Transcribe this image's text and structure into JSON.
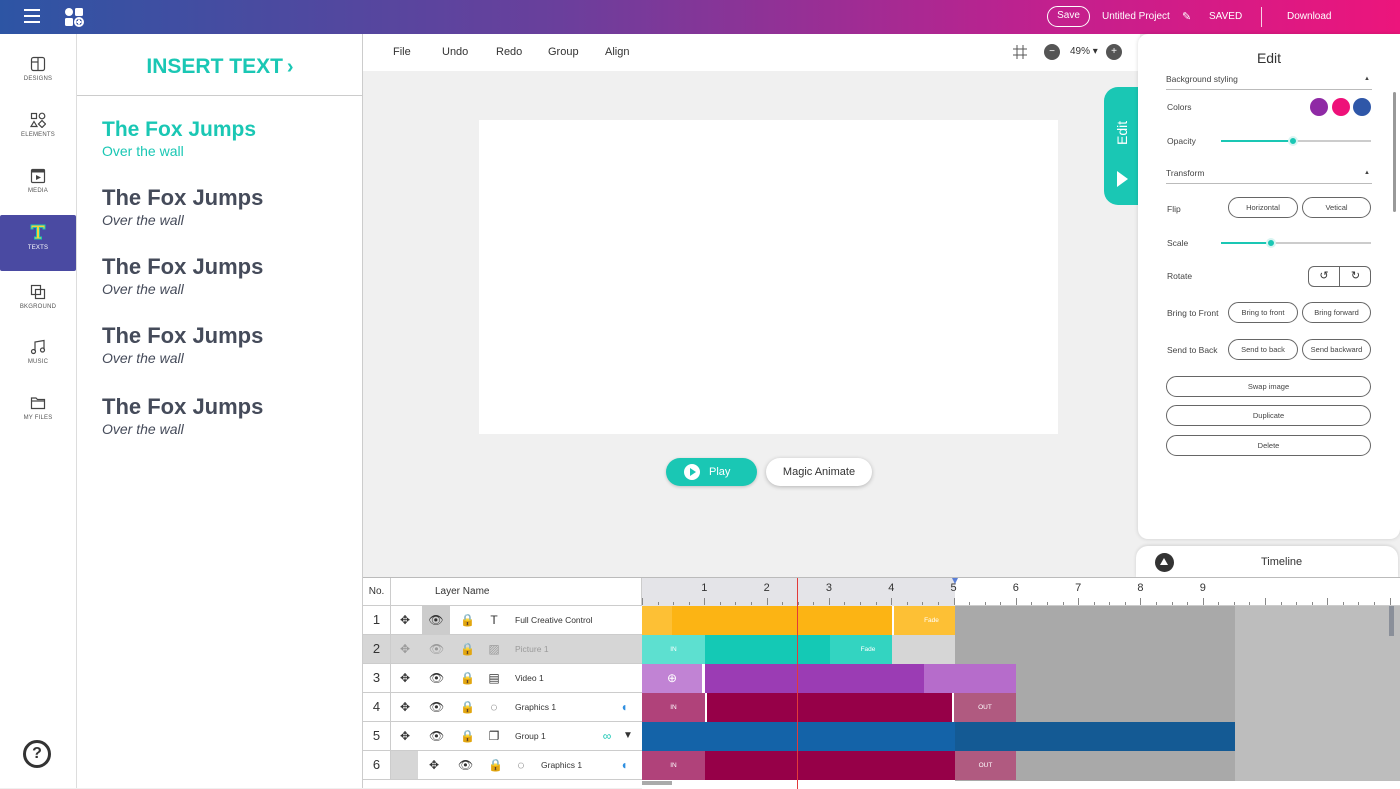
{
  "topbar": {
    "save_label": "Save",
    "project_name": "Untitled Project",
    "saved_status": "SAVED",
    "download_label": "Download"
  },
  "sidebar": {
    "items": [
      {
        "label": "DESIGNS",
        "icon": "designs-icon"
      },
      {
        "label": "ELEMENTS",
        "icon": "elements-icon"
      },
      {
        "label": "MEDIA",
        "icon": "media-icon"
      },
      {
        "label": "TEXTS",
        "icon": "texts-icon"
      },
      {
        "label": "BKGROUND",
        "icon": "background-icon"
      },
      {
        "label": "MUSIC",
        "icon": "music-icon"
      },
      {
        "label": "MY FILES",
        "icon": "folder-icon"
      }
    ],
    "active": "TEXTS",
    "help_label": "?"
  },
  "text_panel": {
    "insert_label": "INSERT TEXT",
    "items": [
      {
        "title": "The Fox Jumps",
        "subtitle": "Over the wall"
      },
      {
        "title": "The Fox Jumps",
        "subtitle": "Over the wall"
      },
      {
        "title": "The Fox Jumps",
        "subtitle": "Over the wall"
      },
      {
        "title": "The Fox Jumps",
        "subtitle": "Over the wall"
      },
      {
        "title": "The Fox Jumps",
        "subtitle": "Over the wall"
      }
    ]
  },
  "toolbar": {
    "file": "File",
    "undo": "Undo",
    "redo": "Redo",
    "group": "Group",
    "align": "Align",
    "zoom": "49%",
    "zoom_caret": "▾"
  },
  "canvas_controls": {
    "play_label": "Play",
    "magic_label": "Magic Animate"
  },
  "edit_tab": {
    "label": "Edit"
  },
  "edit_panel": {
    "title": "Edit",
    "background_styling": "Background styling",
    "colors_label": "Colors",
    "colors": [
      "#8f2aa5",
      "#ee1179",
      "#2f57a8"
    ],
    "opacity_label": "Opacity",
    "opacity_value": 0.48,
    "transform_label": "Transform",
    "flip_label": "Flip",
    "flip_horizontal": "Horizontal",
    "flip_vertical": "Vetical",
    "scale_label": "Scale",
    "scale_value": 0.33,
    "rotate_label": "Rotate",
    "rotate_left": "↺",
    "rotate_right": "↻",
    "bring_front_label": "Bring to Front",
    "bring_to_front": "Bring to front",
    "bring_forward": "Bring forward",
    "send_back_label": "Send to Back",
    "send_to_back": "Send to back",
    "send_backward": "Send backward",
    "swap_image": "Swap image",
    "duplicate": "Duplicate",
    "delete": "Delete",
    "section_caret": "▲"
  },
  "timeline": {
    "title": "Timeline",
    "col_no": "No.",
    "col_name": "Layer Name",
    "ruler": [
      "1",
      "2",
      "3",
      "4",
      "5",
      "6",
      "7",
      "8",
      "9"
    ],
    "rows": [
      {
        "no": "1",
        "name": "Full Creative Control",
        "type": "text-layer-icon",
        "dim": false
      },
      {
        "no": "2",
        "name": "Picture 1",
        "type": "image-layer-icon",
        "dim": true
      },
      {
        "no": "3",
        "name": "Video 1",
        "type": "video-layer-icon",
        "dim": false
      },
      {
        "no": "4",
        "name": "Graphics 1",
        "type": "graphics-layer-icon",
        "dim": false
      },
      {
        "no": "5",
        "name": "Group 1",
        "type": "group-layer-icon",
        "dim": false
      },
      {
        "no": "6",
        "name": "Graphics 1",
        "type": "graphics-layer-icon",
        "dim": false
      }
    ],
    "labels": {
      "fade": "Fade",
      "in": "IN",
      "out": "OUT"
    },
    "colors": {
      "orange": "#fcb414",
      "teal": "#14c9b5",
      "purple": "#9b3cb4",
      "crimson": "#960048",
      "blue": "#1463a8",
      "gray": "#a8a8a8"
    }
  }
}
